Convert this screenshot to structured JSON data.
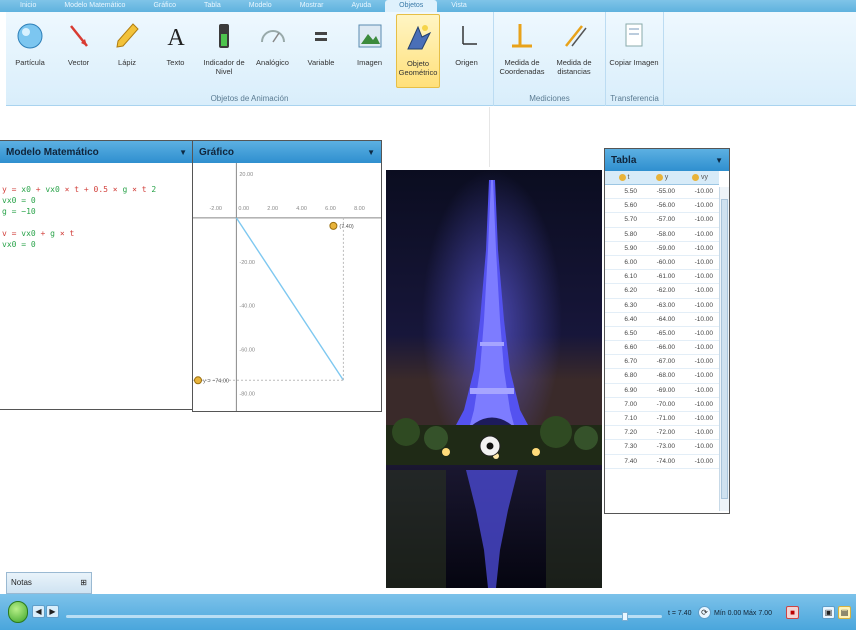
{
  "ribbon": {
    "tabs": [
      "Inicio",
      "Modelo Matemático",
      "Gráfico",
      "Tabla",
      "Modelo",
      "Mostrar",
      "Ayuda",
      "Objetos",
      "Vista"
    ],
    "active_tab_index": 7,
    "groups": {
      "animation": {
        "label": "Objetos de Animación",
        "buttons": [
          {
            "label": "Partícula",
            "icon": "particle-icon"
          },
          {
            "label": "Vector",
            "icon": "vector-icon"
          },
          {
            "label": "Lápiz",
            "icon": "pencil-icon"
          },
          {
            "label": "Texto",
            "icon": "text-icon"
          },
          {
            "label": "Indicador de Nivel",
            "icon": "level-indicator-icon"
          },
          {
            "label": "Analógico",
            "icon": "analog-gauge-icon"
          },
          {
            "label": "Variable",
            "icon": "variable-icon"
          },
          {
            "label": "Imagen",
            "icon": "image-icon"
          },
          {
            "label": "Objeto Geométrico",
            "icon": "geometric-object-icon",
            "active": true
          },
          {
            "label": "Origen",
            "icon": "origin-icon"
          }
        ]
      },
      "measurements": {
        "label": "Mediciones",
        "buttons": [
          {
            "label": "Medida de Coordenadas",
            "icon": "coordinate-measure-icon"
          },
          {
            "label": "Medida de distancias",
            "icon": "distance-measure-icon"
          }
        ]
      },
      "transfer": {
        "label": "Transferencia",
        "buttons": [
          {
            "label": "Copiar Imagen",
            "icon": "copy-image-icon"
          }
        ]
      }
    }
  },
  "math_model": {
    "title": "Modelo Matemático",
    "lines": [
      {
        "parts": [
          [
            "y = ",
            "red"
          ],
          [
            "x0",
            "green"
          ],
          [
            " + ",
            "red"
          ],
          [
            "vx0",
            "green"
          ],
          [
            " × t + 0.5 × ",
            "red"
          ],
          [
            "g",
            "green"
          ],
          [
            " × t ",
            "red"
          ],
          [
            "2",
            "green"
          ]
        ]
      },
      {
        "parts": [
          [
            "vx0",
            "green"
          ],
          [
            " = 0",
            "green"
          ]
        ]
      },
      {
        "parts": [
          [
            "g",
            "green"
          ],
          [
            " = −10",
            "green"
          ]
        ]
      },
      {
        "parts": [
          [
            "",
            "red"
          ]
        ]
      },
      {
        "parts": [
          [
            "v = ",
            "red"
          ],
          [
            "vx0",
            "green"
          ],
          [
            " + ",
            "red"
          ],
          [
            "g",
            "green"
          ],
          [
            " × t",
            "red"
          ]
        ]
      },
      {
        "parts": [
          [
            "vx0",
            "green"
          ],
          [
            " = 0",
            "green"
          ]
        ]
      }
    ]
  },
  "graph": {
    "title": "Gráfico",
    "x_ticks": [
      "-2.00",
      "0.00",
      "2.00",
      "4.00",
      "6.00",
      "8.00"
    ],
    "y_ticks": [
      "20.00",
      "0.00",
      "-20.00",
      "-40.00",
      "-60.00",
      "-80.00"
    ],
    "marker_top_label": "(7.40)",
    "marker_left_label": "y = −74.00"
  },
  "table": {
    "title": "Tabla",
    "columns": [
      "t",
      "y",
      "vy"
    ],
    "rows": [
      [
        "5.50",
        "-55.00",
        "-10.00"
      ],
      [
        "5.60",
        "-56.00",
        "-10.00"
      ],
      [
        "5.70",
        "-57.00",
        "-10.00"
      ],
      [
        "5.80",
        "-58.00",
        "-10.00"
      ],
      [
        "5.90",
        "-59.00",
        "-10.00"
      ],
      [
        "6.00",
        "-60.00",
        "-10.00"
      ],
      [
        "6.10",
        "-61.00",
        "-10.00"
      ],
      [
        "6.20",
        "-62.00",
        "-10.00"
      ],
      [
        "6.30",
        "-63.00",
        "-10.00"
      ],
      [
        "6.40",
        "-64.00",
        "-10.00"
      ],
      [
        "6.50",
        "-65.00",
        "-10.00"
      ],
      [
        "6.60",
        "-66.00",
        "-10.00"
      ],
      [
        "6.70",
        "-67.00",
        "-10.00"
      ],
      [
        "6.80",
        "-68.00",
        "-10.00"
      ],
      [
        "6.90",
        "-69.00",
        "-10.00"
      ],
      [
        "7.00",
        "-70.00",
        "-10.00"
      ],
      [
        "7.10",
        "-71.00",
        "-10.00"
      ],
      [
        "7.20",
        "-72.00",
        "-10.00"
      ],
      [
        "7.30",
        "-73.00",
        "-10.00"
      ],
      [
        "7.40",
        "-74.00",
        "-10.00"
      ]
    ]
  },
  "notes_label": "Notas",
  "statusbar": {
    "time_label": "t = 7.40",
    "range_label": "Mín 0.00 Máx 7.00"
  },
  "colors": {
    "accent": "#2f8fcf",
    "panel_header": "#5cb0e2",
    "graph_line": "#7ec8f0"
  }
}
